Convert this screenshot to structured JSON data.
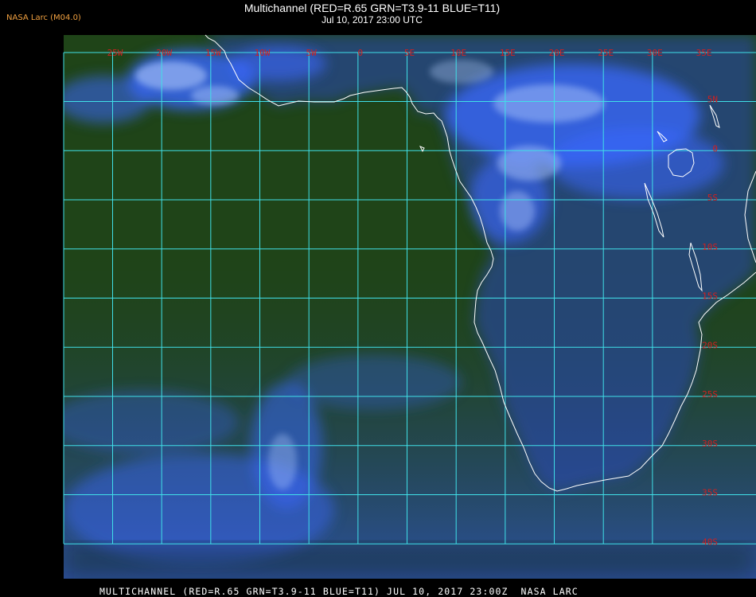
{
  "agency": "NASA Larc (M04.0)",
  "title": "Multichannel (RED=R.65 GRN=T3.9-11 BLUE=T11)",
  "subtitle": "Jul 10, 2017 23:00 UTC",
  "footer": "MULTICHANNEL (RED=R.65 GRN=T3.9-11 BLUE=T11) JUL 10, 2017 23:00Z  NASA LARC",
  "grid": {
    "lon_labels": [
      "25W",
      "20W",
      "15W",
      "10W",
      "5W",
      "0",
      "5E",
      "10E",
      "15E",
      "20E",
      "25E",
      "30E",
      "35E"
    ],
    "lat_labels": [
      "5N",
      "0",
      "5S",
      "10S",
      "15S",
      "20S",
      "25S",
      "30S",
      "35S",
      "40S"
    ]
  },
  "colors": {
    "background": "#000000",
    "ocean": "#1f4418",
    "cloud": "#3a68ff",
    "cloud_bright": "#b8d0ff",
    "gridline": "#40e0e8",
    "grid_label": "#d02020",
    "coastline": "#ffffff",
    "agency_text": "#f0a040"
  }
}
